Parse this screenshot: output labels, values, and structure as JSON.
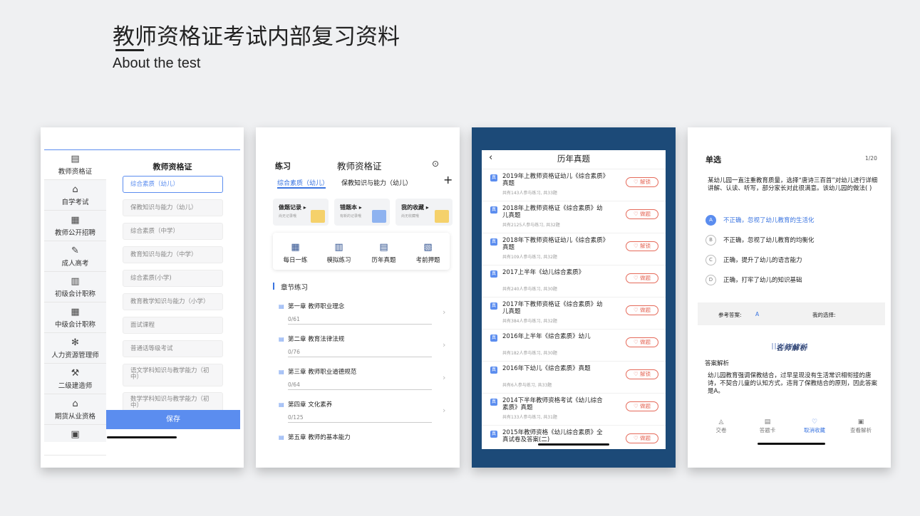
{
  "header": {
    "title": "教师资格证考试内部复习资料",
    "subtitle": "About the test"
  },
  "screen1": {
    "heading": "教师资格证",
    "sidebar": [
      {
        "label": "教师资格证",
        "icon": "certificate-icon"
      },
      {
        "label": "自学考试",
        "icon": "graduation-cap-icon"
      },
      {
        "label": "教师公开招聘",
        "icon": "calendar-icon"
      },
      {
        "label": "成人高考",
        "icon": "pen-icon"
      },
      {
        "label": "初级会计职称",
        "icon": "abacus-icon"
      },
      {
        "label": "中级会计职称",
        "icon": "calculator-icon"
      },
      {
        "label": "人力资源管理师",
        "icon": "atom-icon"
      },
      {
        "label": "二级建造师",
        "icon": "hammer-icon"
      },
      {
        "label": "期货从业资格",
        "icon": "bank-icon"
      },
      {
        "label": "",
        "icon": "bag-icon"
      }
    ],
    "options": [
      "综合素质（幼儿）",
      "保教知识与能力（幼儿）",
      "综合素质（中学）",
      "教育知识与能力（中学）",
      "综合素质(小学)",
      "教育教学知识与能力（小学）",
      "面试课程",
      "普通话等级考试",
      "语文学科知识与教学能力（初中）",
      "数学学科知识与教学能力（初中）"
    ],
    "save_label": "保存"
  },
  "screen2": {
    "practice_label": "练习",
    "title": "教师资格证",
    "tabs": [
      "综合素质（幼儿）",
      "保教知识与能力（幼儿）"
    ],
    "boxes": [
      {
        "title": "做题记录 ▸",
        "sub": "尚无记录哦"
      },
      {
        "title": "错题本 ▸",
        "sub": "有新的记录哦"
      },
      {
        "title": "我的收藏 ▸",
        "sub": "尚无收藏哦"
      }
    ],
    "grid": [
      {
        "label": "每日一练",
        "icon": "calendar-icon"
      },
      {
        "label": "模拟练习",
        "icon": "book-icon"
      },
      {
        "label": "历年真题",
        "icon": "printer-icon"
      },
      {
        "label": "考前押题",
        "icon": "stack-icon"
      }
    ],
    "section_title": "章节练习",
    "chapters": [
      {
        "title": "第一章  教师职业理念",
        "progress": "0/61"
      },
      {
        "title": "第二章  教育法律法规",
        "progress": "0/76"
      },
      {
        "title": "第三章  教师职业道德规范",
        "progress": "0/64"
      },
      {
        "title": "第四章  文化素养",
        "progress": "0/125"
      },
      {
        "title": "第五章  教师的基本能力",
        "progress": ""
      }
    ]
  },
  "screen3": {
    "title": "历年真题",
    "badge": "真",
    "items": [
      {
        "title": "2019年上教师资格证幼儿《综合素质》真题",
        "meta": "共有143人参与练习, 共33题",
        "action": "解锁"
      },
      {
        "title": "2018年上教师资格证《综合素质》幼儿真题",
        "meta": "共有2125人参与练习, 共32题",
        "action": "做题"
      },
      {
        "title": "2018年下教师资格证幼儿《综合素质》真题",
        "meta": "共有109人参与练习, 共32题",
        "action": "解锁"
      },
      {
        "title": "2017上半年《幼儿综合素质》",
        "meta": "共有240人参与练习, 共30题",
        "action": "做题"
      },
      {
        "title": "2017年下教师资格证《综合素质》幼儿真题",
        "meta": "共有384人参与练习, 共32题",
        "action": "做题"
      },
      {
        "title": "2016年上半年《综合素质》幼儿",
        "meta": "共有182人参与练习, 共30题",
        "action": "做题"
      },
      {
        "title": "2016年下幼儿《综合素质》真题",
        "meta": "共有6人参与练习, 共33题",
        "action": "解锁"
      },
      {
        "title": "2014下半年教师资格考试《幼儿综合素质》真题",
        "meta": "共有133人参与练习, 共31题",
        "action": "做题"
      },
      {
        "title": "2015年教师资格《幼儿综合素质》全真试卷及答案(二)",
        "meta": "",
        "action": "做题"
      }
    ]
  },
  "screen4": {
    "type": "单选",
    "count": "1/20",
    "question": "某幼儿园一直注重教育质量，选择“唐诗三百首”对幼儿进行详细讲解、认读、听写，部分家长对此很满意。该幼儿园的做法(   )",
    "options": [
      {
        "key": "A",
        "text": "不正确，忽视了幼儿教育的生活化"
      },
      {
        "key": "B",
        "text": "不正确，忽视了幼儿教育的均衡化"
      },
      {
        "key": "C",
        "text": "正确，提升了幼儿的语言能力"
      },
      {
        "key": "D",
        "text": "正确，打牢了幼儿的知识基础"
      }
    ],
    "answer_label": "参考答案:",
    "answer_value": "A",
    "my_choice_label": "我的选择:",
    "badge": "名师解析",
    "explanation_heading": "答案解析",
    "explanation": "幼儿园教育强调保教结合，过早呈现没有生活常识相衔接的唐诗，不契合儿童的认知方式，违背了保教结合的原则，因此答案是A。",
    "bottom": [
      "交卷",
      "答题卡",
      "取消收藏",
      "查看解析"
    ]
  },
  "colors": {
    "accent": "#5b8def",
    "brand_blue": "#3a74e0",
    "dark_panel": "#1c4a78",
    "warn": "#e56a5a"
  }
}
